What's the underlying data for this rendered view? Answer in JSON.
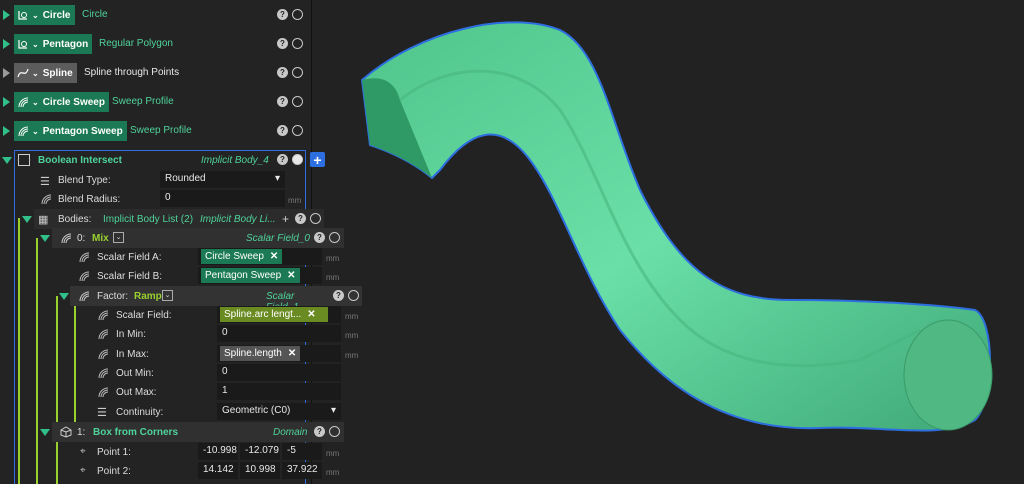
{
  "nodes": [
    {
      "name": "Circle",
      "subtitle": "Circle"
    },
    {
      "name": "Pentagon",
      "subtitle": "Regular Polygon"
    },
    {
      "name": "Spline",
      "subtitle": "Spline through Points"
    },
    {
      "name": "Circle Sweep",
      "subtitle": "Sweep Profile"
    },
    {
      "name": "Pentagon Sweep",
      "subtitle": "Sweep Profile"
    }
  ],
  "boolean": {
    "title": "Boolean Intersect",
    "type": "Implicit Body_4",
    "blend_type_label": "Blend Type:",
    "blend_type_value": "Rounded",
    "blend_radius_label": "Blend Radius:",
    "blend_radius_value": "0",
    "bodies_label": "Bodies:",
    "bodies_value": "Implicit Body List (2)",
    "bodies_type": "Implicit Body Li..."
  },
  "mix": {
    "index": "0:",
    "title": "Mix",
    "type": "Scalar Field_0",
    "field_a_label": "Scalar Field A:",
    "field_a_value": "Circle Sweep",
    "field_b_label": "Scalar Field B:",
    "field_b_value": "Pentagon Sweep"
  },
  "factor": {
    "label": "Factor:",
    "title": "Ramp",
    "type": "Scalar Field_1",
    "scalar_label": "Scalar Field:",
    "scalar_value": "Spline.arc lengt...",
    "in_min_label": "In Min:",
    "in_min_value": "0",
    "in_max_label": "In Max:",
    "in_max_value": "Spline.length",
    "out_min_label": "Out Min:",
    "out_min_value": "0",
    "out_max_label": "Out Max:",
    "out_max_value": "1",
    "continuity_label": "Continuity:",
    "continuity_value": "Geometric (C0)"
  },
  "box": {
    "index": "1:",
    "title": "Box from Corners",
    "type": "Domain",
    "p1_label": "Point 1:",
    "p1": [
      "-10.998",
      "-12.079",
      "-5"
    ],
    "p2_label": "Point 2:",
    "p2": [
      "14.142",
      "10.998",
      "37.922"
    ]
  },
  "unit": "mm",
  "colors": {
    "accent": "#1b7a55",
    "shape": "#5fd49b",
    "outline": "#2d6fe0"
  }
}
